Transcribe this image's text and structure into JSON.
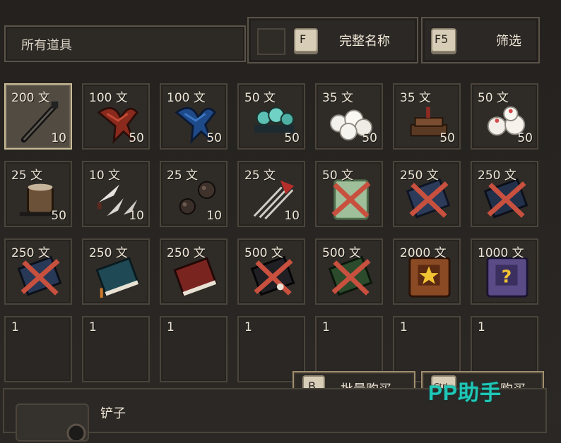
{
  "header": {
    "category": "所有道具",
    "name_key": "F",
    "name_label": "完整名称",
    "filter_key": "F5",
    "filter_label": "筛选"
  },
  "rows": [
    [
      {
        "price": "200 文",
        "qty": "10",
        "icon": "shovel-icon",
        "selected": true
      },
      {
        "price": "100 文",
        "qty": "50",
        "icon": "red-mixture-icon"
      },
      {
        "price": "100 文",
        "qty": "50",
        "icon": "blue-mixture-icon"
      },
      {
        "price": "50 文",
        "qty": "50",
        "icon": "teal-stones-icon"
      },
      {
        "price": "35 文",
        "qty": "50",
        "icon": "white-buns-icon"
      },
      {
        "price": "35 文",
        "qty": "50",
        "icon": "chocolate-cake-icon"
      },
      {
        "price": "50 文",
        "qty": "50",
        "icon": "pink-buns-icon"
      }
    ],
    [
      {
        "price": "25 文",
        "qty": "50",
        "icon": "pot-icon"
      },
      {
        "price": "10 文",
        "qty": "10",
        "icon": "throwing-knives-icon"
      },
      {
        "price": "25 文",
        "qty": "10",
        "icon": "iron-balls-icon"
      },
      {
        "price": "25 文",
        "qty": "10",
        "icon": "needles-icon"
      },
      {
        "price": "50 文",
        "qty": "",
        "icon": "scroll-crossed-icon"
      },
      {
        "price": "250 文",
        "qty": "",
        "icon": "red-book-crossed-icon"
      },
      {
        "price": "250 文",
        "qty": "",
        "icon": "dark-book-crossed-icon"
      }
    ],
    [
      {
        "price": "250 文",
        "qty": "",
        "icon": "navy-book-crossed-icon"
      },
      {
        "price": "250 文",
        "qty": "",
        "icon": "teal-book-icon"
      },
      {
        "price": "250 文",
        "qty": "",
        "icon": "crimson-book-icon"
      },
      {
        "price": "500 文",
        "qty": "",
        "icon": "black-book-crossed-icon"
      },
      {
        "price": "500 文",
        "qty": "",
        "icon": "green-book-crossed-icon"
      },
      {
        "price": "2000 文",
        "qty": "",
        "icon": "star-chest-icon"
      },
      {
        "price": "1000 文",
        "qty": "",
        "icon": "mystery-chest-icon"
      }
    ],
    [
      {
        "price": "1",
        "qty": "",
        "icon": "",
        "empty": true
      },
      {
        "price": "1",
        "qty": "",
        "icon": "",
        "empty": true
      },
      {
        "price": "1",
        "qty": "",
        "icon": "",
        "empty": true
      },
      {
        "price": "1",
        "qty": "",
        "icon": "",
        "empty": true
      },
      {
        "price": "1",
        "qty": "",
        "icon": "",
        "empty": true
      },
      {
        "price": "1",
        "qty": "",
        "icon": "",
        "empty": true
      },
      {
        "price": "1",
        "qty": "",
        "icon": "",
        "empty": true
      }
    ]
  ],
  "actions": {
    "bulk_key": "B",
    "bulk_label": "批量购买",
    "buy_key": "Ctrl",
    "buy_label": "购买"
  },
  "detail": {
    "item_name": "铲子"
  },
  "watermark": "PP助手",
  "colors": {
    "accent": "#c9bd98",
    "watermark": "#1fc7b6",
    "crossed": "#c8503e"
  }
}
